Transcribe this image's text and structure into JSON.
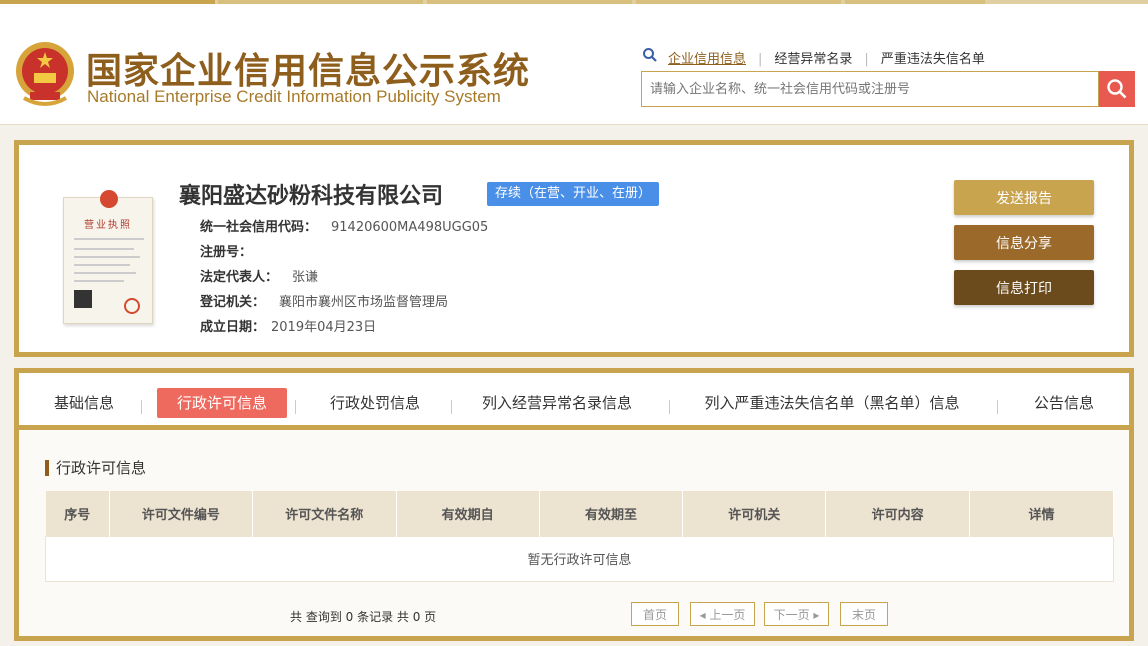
{
  "header": {
    "title": "国家企业信用信息公示系统",
    "subtitle": "National Enterprise Credit Information Publicity System",
    "nav": [
      {
        "label": "企业信用信息"
      },
      {
        "label": "经营异常名录"
      },
      {
        "label": "严重违法失信名单"
      }
    ],
    "search_placeholder": "请输入企业名称、统一社会信用代码或注册号"
  },
  "company": {
    "name": "襄阳盛达砂粉科技有限公司",
    "status": "存续（在营、开业、在册）",
    "license_text": "营业执照",
    "fields": [
      {
        "key": "统一社会信用代码：",
        "value": "91420600MA498UGG05"
      },
      {
        "key": "注册号：",
        "value": ""
      },
      {
        "key": "法定代表人：",
        "value": "张谦"
      },
      {
        "key": "登记机关：",
        "value": "襄阳市襄州区市场监督管理局"
      },
      {
        "key": "成立日期：",
        "value": "2019年04月23日"
      }
    ],
    "buttons": {
      "send_report": "发送报告",
      "share": "信息分享",
      "print": "信息打印"
    }
  },
  "tabs": [
    {
      "label": "基础信息"
    },
    {
      "label": "行政许可信息"
    },
    {
      "label": "行政处罚信息"
    },
    {
      "label": "列入经营异常名录信息"
    },
    {
      "label": "列入严重违法失信名单（黑名单）信息"
    },
    {
      "label": "公告信息"
    }
  ],
  "section": {
    "title": "行政许可信息",
    "columns": [
      "序号",
      "许可文件编号",
      "许可文件名称",
      "有效期自",
      "有效期至",
      "许可机关",
      "许可内容",
      "详情"
    ],
    "empty_text": "暂无行政许可信息"
  },
  "pager": {
    "summary": "共 查询到 0 条记录 共 0 页",
    "first": "首页",
    "prev": "◂ 上一页",
    "next": "下一页 ▸",
    "last": "末页"
  },
  "colors": {
    "gold": "#c9a44f",
    "brown": "#8e5e1d",
    "tab_active": "#ef6a5e",
    "badge": "#4a8fe7",
    "search_btn": "#e85a4f"
  }
}
